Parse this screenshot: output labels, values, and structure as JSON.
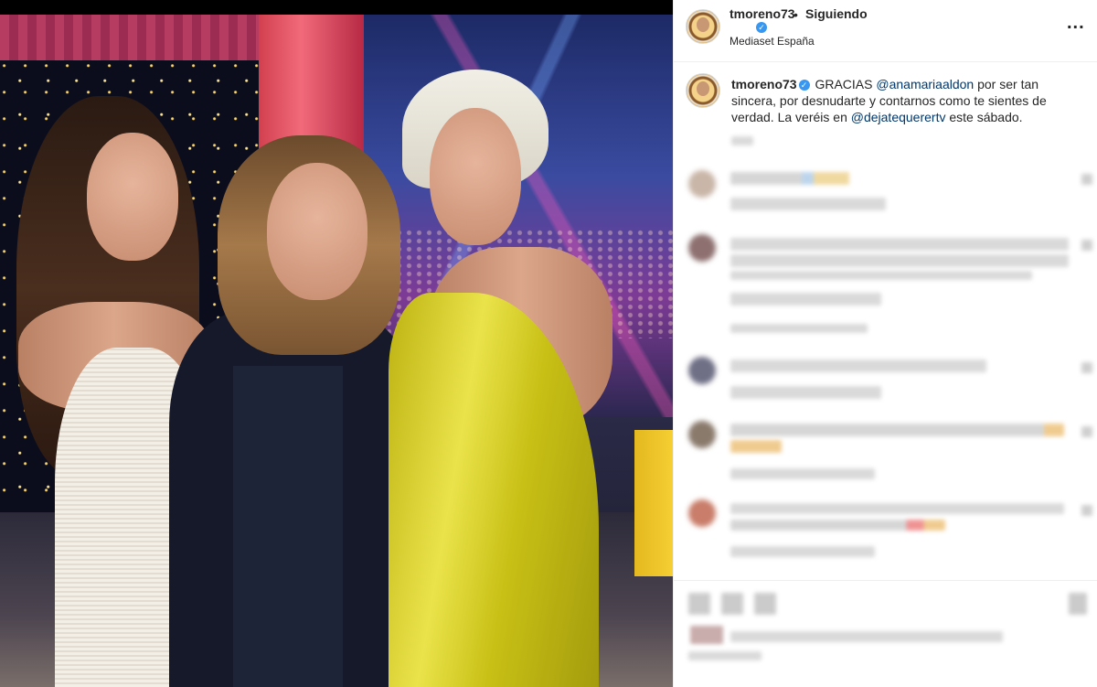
{
  "post": {
    "author": "tmoreno73",
    "verified_mark": "✓",
    "separator": "•",
    "follow_state": "Siguiendo",
    "location": "Mediaset España",
    "more_icon": "...",
    "caption": {
      "author": "tmoreno73",
      "text_1": " GRACIAS ",
      "mention_1": "@anamariaaldon",
      "text_2": " por ser tan sincera, por desnudarte y contarnos como te sientes de verdad. La veréis en ",
      "mention_2": "@dejatequerertv",
      "text_3": " este sábado."
    },
    "colors": {
      "mention": "#00376b",
      "verified": "#3897f0",
      "text": "#262626"
    }
  }
}
